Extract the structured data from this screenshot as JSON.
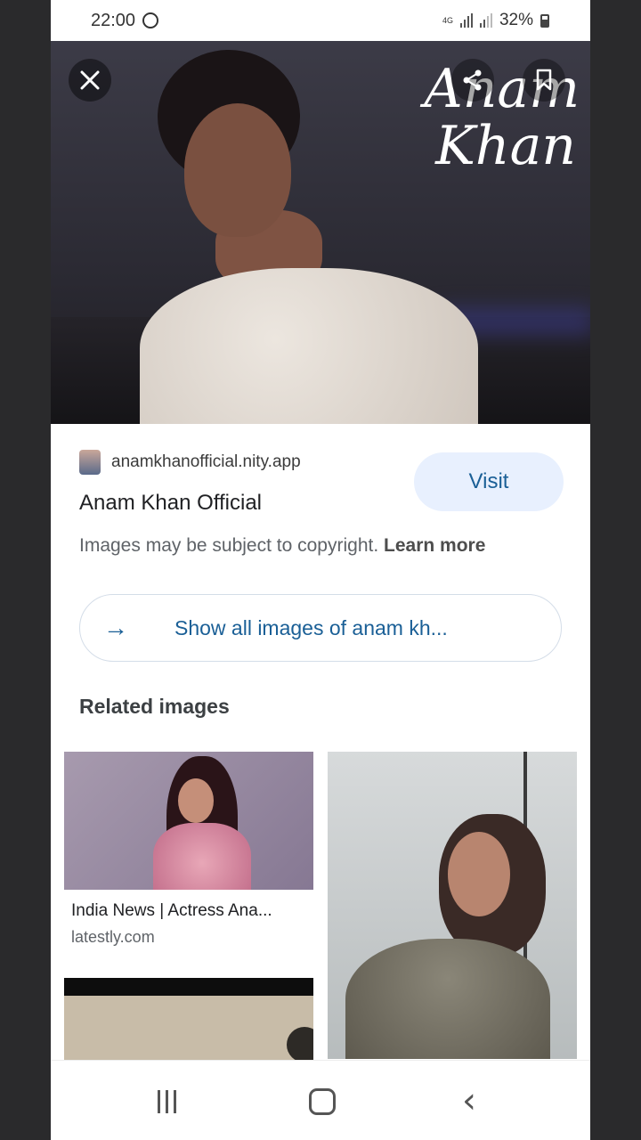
{
  "status_bar": {
    "time": "22:00",
    "network": "4G",
    "battery_percent": "32%",
    "battery_level": 0.32
  },
  "hero": {
    "title_line1": "Anam",
    "title_line2": "Khan",
    "close_icon": "close-icon",
    "share_icon": "share-icon",
    "bookmark_icon": "bookmark-icon"
  },
  "source": {
    "domain": "anamkhanofficial.nity.app",
    "title": "Anam Khan Official",
    "visit_label": "Visit",
    "copyright_text": "Images may be subject to copyright.",
    "learn_more": "Learn more"
  },
  "show_all": {
    "label": "Show all images of anam kh...",
    "arrow": "→"
  },
  "related": {
    "heading": "Related images",
    "items": [
      {
        "caption": "India News | Actress Ana...",
        "source": "latestly.com"
      }
    ]
  },
  "colors": {
    "accent": "#1a5f96",
    "visit_bg": "#e8f0fe",
    "text_primary": "#202124",
    "text_secondary": "#5f6368"
  }
}
